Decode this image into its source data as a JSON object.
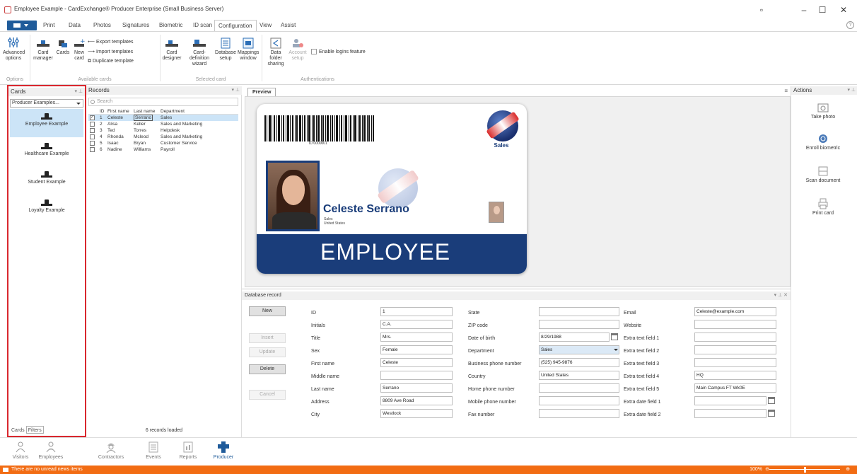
{
  "window": {
    "title": "Employee Example - CardExchange® Producer Enterprise (Small Business Server)",
    "controls": {
      "restore": "▫",
      "minimize": "–",
      "maximize": "☐",
      "close": "✕"
    }
  },
  "menu": {
    "tabs": [
      "Print",
      "Data",
      "Photos",
      "Signatures",
      "Biometric",
      "ID scan",
      "Configuration",
      "View",
      "Assist"
    ],
    "active": "Configuration",
    "help": "?"
  },
  "ribbon": {
    "options_group": {
      "label": "Options",
      "advanced": "Advanced options"
    },
    "available_cards": {
      "label": "Available cards",
      "card_manager": "Card manager",
      "cards": "Cards",
      "new_card": "New card",
      "export_templates": "Export templates",
      "import_templates": "Import templates",
      "duplicate_template": "Duplicate template"
    },
    "selected_card": {
      "label": "Selected card",
      "card_designer": "Card designer",
      "definition_wizard": "Card-definition wizard",
      "database_setup": "Database setup",
      "mappings_window": "Mappings window"
    },
    "authentications": {
      "label": "Authentications",
      "data_folder_sharing": "Data folder sharing",
      "account_setup": "Account setup",
      "enable_logins": "Enable logins feature"
    }
  },
  "cards_panel": {
    "title": "Cards",
    "selected_group": "Producer Examples...",
    "items": [
      "Employee Example",
      "Healthcare Example",
      "Student Example",
      "Loyalty Example"
    ],
    "tabs": [
      "Cards",
      "Filters"
    ]
  },
  "records_panel": {
    "title": "Records",
    "search_placeholder": "Search",
    "columns": [
      "ID",
      "First name",
      "Last name",
      "Department"
    ],
    "rows": [
      {
        "check": "✓",
        "id": "1",
        "first": "Celeste",
        "last": "Serrano",
        "dept": "Sales"
      },
      {
        "check": "",
        "id": "2",
        "first": "Alisa",
        "last": "Keller",
        "dept": "Sales and Marketing"
      },
      {
        "check": "",
        "id": "3",
        "first": "Ted",
        "last": "Torres",
        "dept": "Helpdesk"
      },
      {
        "check": "",
        "id": "4",
        "first": "Rhonda",
        "last": "Mcleod",
        "dept": "Sales and Marketing"
      },
      {
        "check": "",
        "id": "5",
        "first": "Isaac",
        "last": "Bryan",
        "dept": "Customer Service"
      },
      {
        "check": "",
        "id": "6",
        "first": "Nadine",
        "last": "Williams",
        "dept": "Payroll"
      }
    ],
    "status": "6 records loaded"
  },
  "preview": {
    "tab": "Preview",
    "card": {
      "barcode_number": "ID 0000001",
      "department": "Sales",
      "name": "Celeste Serrano",
      "line1": "Sales",
      "line2": "United States",
      "banner": "EMPLOYEE"
    }
  },
  "database_record": {
    "title": "Database record",
    "buttons": [
      "New",
      "Insert",
      "Update",
      "Delete",
      "Cancel"
    ],
    "col1": [
      {
        "label": "ID",
        "value": "1"
      },
      {
        "label": "Initials",
        "value": "C.A."
      },
      {
        "label": "Title",
        "value": "Mrs."
      },
      {
        "label": "Sex",
        "value": "Female"
      },
      {
        "label": "First name",
        "value": "Celeste"
      },
      {
        "label": "Middle name",
        "value": ""
      },
      {
        "label": "Last name",
        "value": "Serrano"
      },
      {
        "label": "Address",
        "value": "8809 Ave Road"
      },
      {
        "label": "City",
        "value": "Westlock"
      }
    ],
    "col2": [
      {
        "label": "State",
        "value": ""
      },
      {
        "label": "ZIP code",
        "value": ""
      },
      {
        "label": "Date of birth",
        "value": "8/29/1988"
      },
      {
        "label": "Department",
        "value": "Sales"
      },
      {
        "label": "Business phone number",
        "value": "(525) 945-9876"
      },
      {
        "label": "Country",
        "value": "United States"
      },
      {
        "label": "Home phone number",
        "value": ""
      },
      {
        "label": "Mobile phone number",
        "value": ""
      },
      {
        "label": "Fax number",
        "value": ""
      }
    ],
    "col3": [
      {
        "label": "Email",
        "value": "Celeste@example.com"
      },
      {
        "label": "Website",
        "value": ""
      },
      {
        "label": "Extra text field 1",
        "value": ""
      },
      {
        "label": "Extra text field 2",
        "value": ""
      },
      {
        "label": "Extra text field 3",
        "value": ""
      },
      {
        "label": "Extra text field 4",
        "value": "HQ"
      },
      {
        "label": "Extra text field 5",
        "value": "Main Campus FT Wk0E"
      },
      {
        "label": "Extra date field 1",
        "value": ""
      },
      {
        "label": "Extra date field 2",
        "value": ""
      }
    ]
  },
  "actions_panel": {
    "title": "Actions",
    "items": [
      "Take photo",
      "Enroll biometric",
      "Scan document",
      "Print card"
    ]
  },
  "navbar": {
    "items": [
      "Visitors",
      "Employees",
      "Contractors",
      "Events",
      "Reports",
      "Producer"
    ]
  },
  "statusbar": {
    "message": "There are no unread news items",
    "zoom": "100%"
  },
  "colors": {
    "accent": "#1f5b9a",
    "card_blue": "#1a3d7a",
    "status_orange": "#f26c13",
    "highlight_red": "#d9272e",
    "selection": "#cce4f7"
  }
}
